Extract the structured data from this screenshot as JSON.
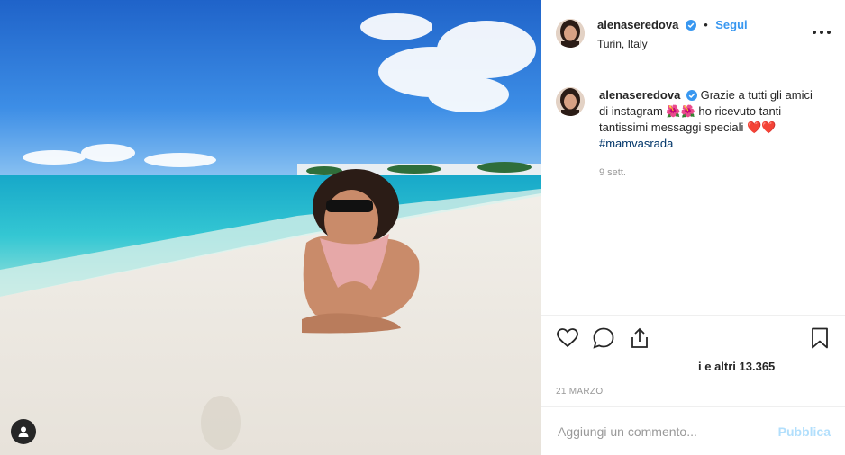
{
  "post": {
    "username": "alenaseredova",
    "follow_label": "Segui",
    "separator": "•",
    "location": "Turin, Italy",
    "caption_text": "Grazie a tutti gli amici di instagram 🌺🌺 ho ricevuto tanti tantissimi messaggi speciali ❤️❤️",
    "hashtag": "#mamvasrada",
    "caption_age": "9 sett.",
    "likes_text": "i e altri 13.365",
    "date": "21 MARZO",
    "comment_placeholder": "Aggiungi un commento...",
    "publish_label": "Pubblica"
  },
  "icons": {
    "verified": "verified-badge-icon",
    "more": "more-options-icon",
    "like": "heart-icon",
    "comment": "comment-bubble-icon",
    "share": "share-icon",
    "save": "bookmark-icon",
    "user_tag": "user-tag-icon"
  },
  "colors": {
    "link": "#3897f0",
    "hashtag": "#003569",
    "muted": "#999999",
    "publish_disabled": "#b2dffc"
  }
}
